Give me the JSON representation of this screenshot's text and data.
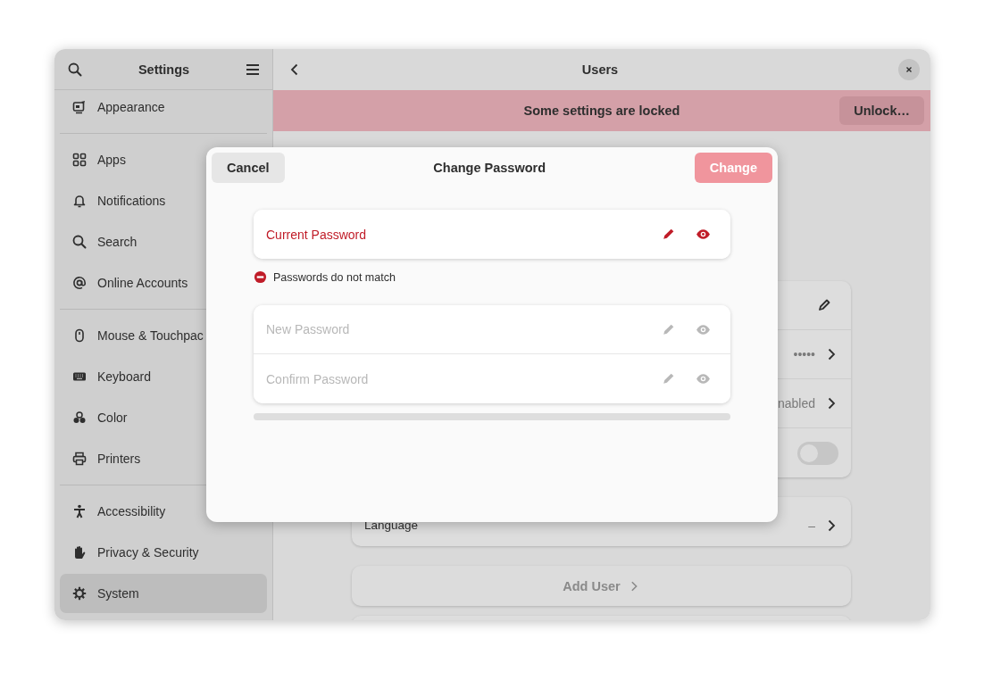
{
  "sidebar": {
    "title": "Settings",
    "sections": [
      [
        {
          "label": "Appearance",
          "selected": false
        }
      ],
      [
        {
          "label": "Apps",
          "selected": false
        },
        {
          "label": "Notifications",
          "selected": false
        },
        {
          "label": "Search",
          "selected": false
        },
        {
          "label": "Online Accounts",
          "selected": false
        }
      ],
      [
        {
          "label": "Mouse & Touchpac",
          "selected": false
        },
        {
          "label": "Keyboard",
          "selected": false
        },
        {
          "label": "Color",
          "selected": false
        },
        {
          "label": "Printers",
          "selected": false
        }
      ],
      [
        {
          "label": "Accessibility",
          "selected": false
        },
        {
          "label": "Privacy & Security",
          "selected": false
        },
        {
          "label": "System",
          "selected": true
        }
      ]
    ]
  },
  "header": {
    "title": "Users"
  },
  "banner": {
    "text": "Some settings are locked",
    "button": "Unlock…"
  },
  "account_rows": [
    {
      "kind": "edit"
    },
    {
      "kind": "value",
      "value": "•••••"
    },
    {
      "kind": "value",
      "value": "nabled"
    },
    {
      "kind": "toggle",
      "on": false
    }
  ],
  "language_row": {
    "label": "Language",
    "value": "–"
  },
  "add_user": {
    "label": "Add User"
  },
  "dialog": {
    "title": "Change Password",
    "cancel": "Cancel",
    "confirm": {
      "label": "Change",
      "disabled": true
    },
    "groups": [
      {
        "fields": [
          {
            "placeholder": "Current Password",
            "error": true,
            "disabled": false
          }
        ],
        "error": "Passwords do not match"
      },
      {
        "fields": [
          {
            "placeholder": "New Password",
            "error": false,
            "disabled": true
          },
          {
            "placeholder": "Confirm Password",
            "error": false,
            "disabled": true
          }
        ]
      }
    ],
    "strength": {
      "level": 0
    }
  }
}
